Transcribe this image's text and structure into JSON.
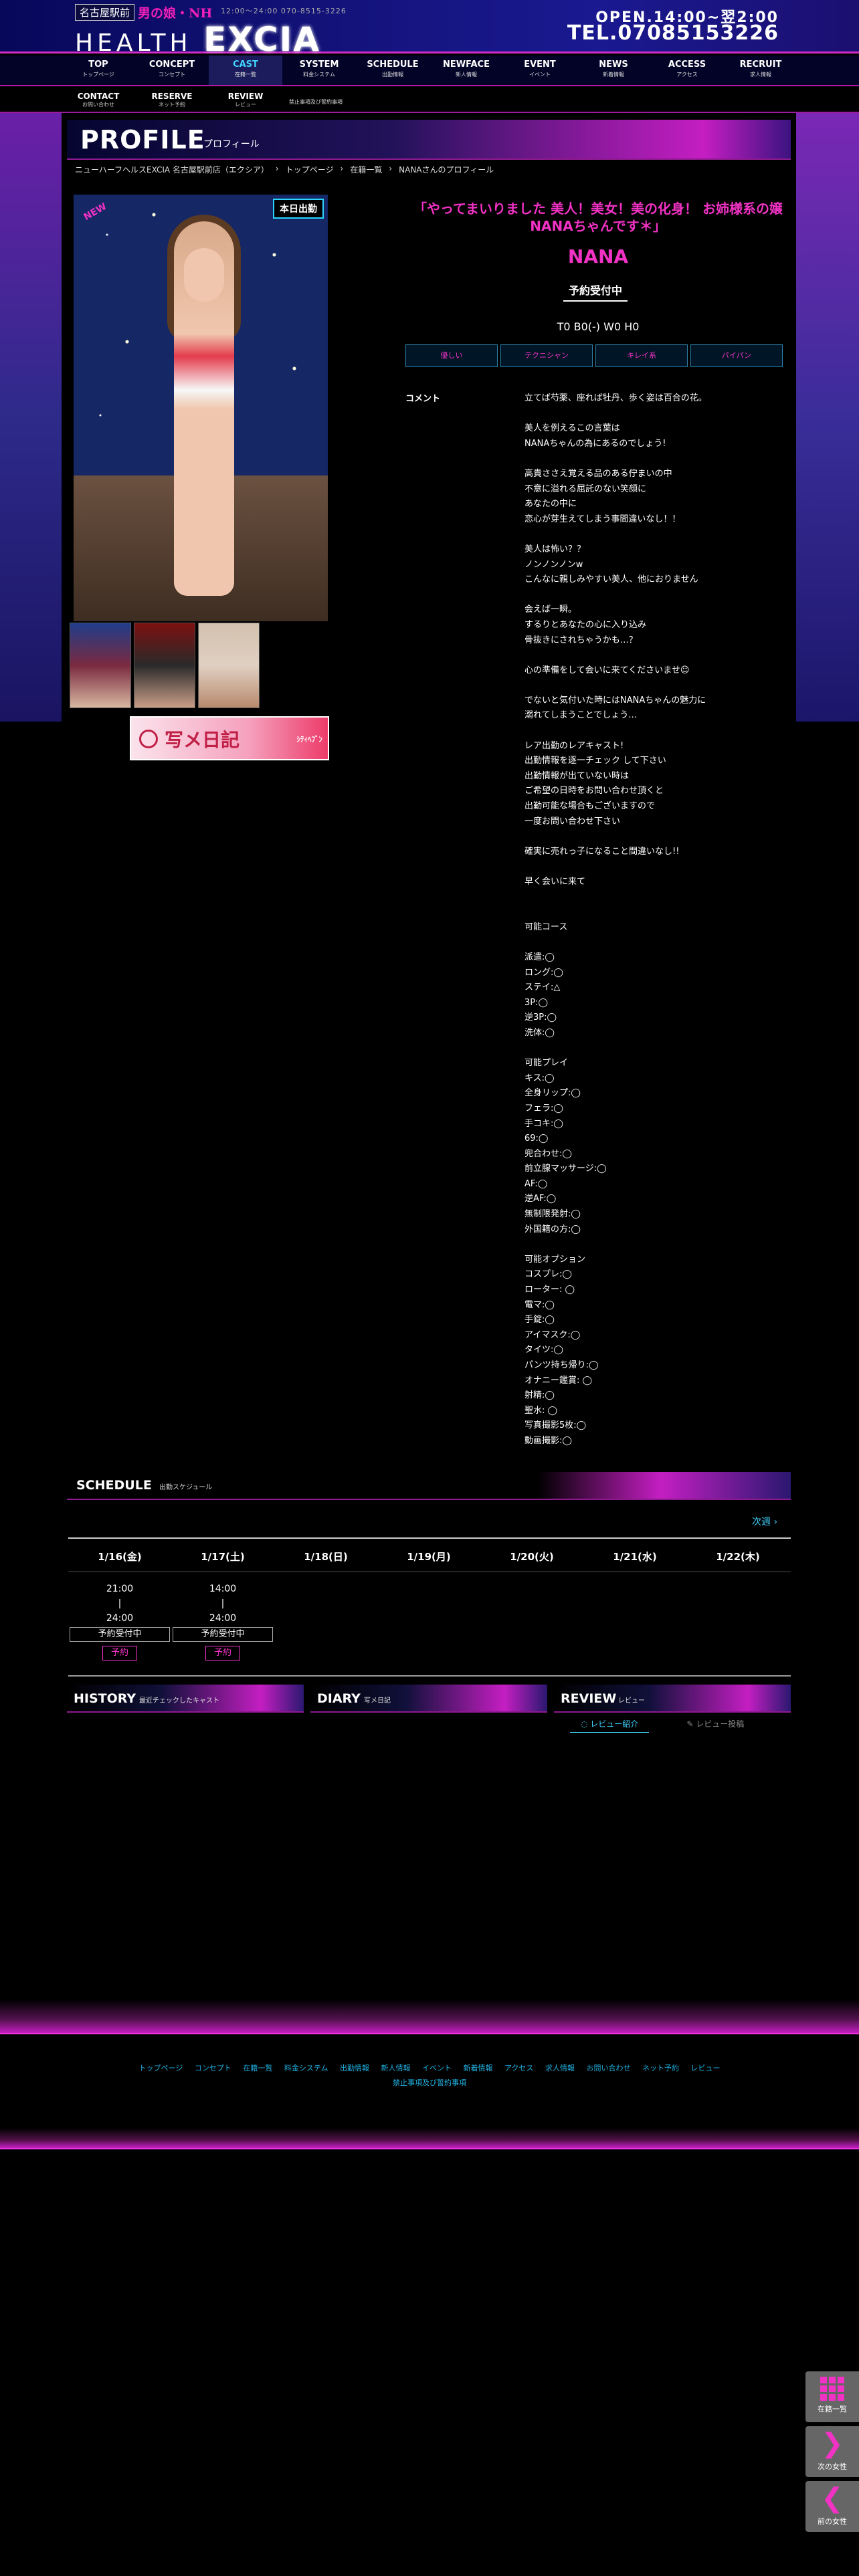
{
  "header": {
    "area_tag": "名古屋駅前",
    "sub_title": "男の娘・NH",
    "hours_small": "12:00～24:00 070-8515-3226",
    "logo_prefix": "HEALTH",
    "logo_brand": "EXCIA",
    "open": "OPEN.14:00~翌2:00",
    "tel": "TEL.07085153226"
  },
  "nav": [
    {
      "en": "TOP",
      "jp": "トップページ"
    },
    {
      "en": "CONCEPT",
      "jp": "コンセプト"
    },
    {
      "en": "CAST",
      "jp": "在籍一覧"
    },
    {
      "en": "SYSTEM",
      "jp": "料金システム"
    },
    {
      "en": "SCHEDULE",
      "jp": "出勤情報"
    },
    {
      "en": "NEWFACE",
      "jp": "新人情報"
    },
    {
      "en": "EVENT",
      "jp": "イベント"
    },
    {
      "en": "NEWS",
      "jp": "新着情報"
    },
    {
      "en": "ACCESS",
      "jp": "アクセス"
    },
    {
      "en": "RECRUIT",
      "jp": "求人情報"
    }
  ],
  "subnav": [
    {
      "en": "CONTACT",
      "jp": "お問い合わせ"
    },
    {
      "en": "RESERVE",
      "jp": "ネット予約"
    },
    {
      "en": "REVIEW",
      "jp": "レビュー"
    }
  ],
  "subnav_ban": "禁止事項及び誓約事項",
  "profile": {
    "title_en": "PROFILE",
    "title_jp": "プロフィール"
  },
  "breadcrumb": [
    "ニューハーフヘルスEXCIA 名古屋駅前店（エクシア）",
    "トップページ",
    "在籍一覧",
    "NANAさんのプロフィール"
  ],
  "photo": {
    "badge_new": "NEW",
    "badge_today": "本日出勤"
  },
  "diary_banner": {
    "text": "写メ日記",
    "sub": "ｼﾃｨﾍﾌﾞﾝ"
  },
  "cast": {
    "catch": "「やってまいりました 美人！美女！美の化身！ お姉様系の嬢 NANAちゃんです＊」",
    "name": "NANA",
    "status": "予約受付中",
    "spec": "T0 B0(-) W0 H0",
    "tags": [
      "優しい",
      "テクニシャン",
      "キレイ系",
      "パイパン"
    ],
    "comment_label": "コメント",
    "comment": "立てば芍薬、座れば牡丹、歩く姿は百合の花。\n\n美人を例えるこの言葉は\nNANAちゃんの為にあるのでしょう!\n\n高貴ささえ覚える品のある佇まいの中\n不意に溢れる屈託のない笑顔に\nあなたの中に\n恋心が芽生えてしまう事間違いなし！！\n\n美人は怖い？？\nノンノンノンw\nこんなに親しみやすい美人、他におりません\n\n会えば一瞬。\nするりとあなたの心に入り込み\n骨抜きにされちゃうかも…？\n\n心の準備をして会いに来てくださいませ☺\n\nでないと気付いた時にはNANAちゃんの魅力に\n溺れてしまうことでしょう…\n\nレア出勤のレアキャスト!\n出勤情報を逐一チェック して下さい\n出勤情報が出ていない時は\nご希望の日時をお問い合わせ頂くと\n出勤可能な場合もございますので\n一度お問い合わせ下さい\n\n確実に売れっ子になること間違いなし!!\n\n早く会いに来て\n\n\n可能コース\n\n派遣:◯\nロング:◯\nステイ:△\n3P:◯\n逆3P:◯\n洗体:◯\n\n可能プレイ\nキス:◯\n全身リップ:◯\nフェラ:◯\n手コキ:◯\n69:◯\n兜合わせ:◯\n前立腺マッサージ:◯\nAF:◯\n逆AF:◯\n無制限発射:◯\n外国籍の方:◯\n\n可能オプション\nコスプレ:◯\nローター: ◯\n電マ:◯\n手錠:◯\nアイマスク:◯\nタイツ:◯\nパンツ持ち帰り:◯\nオナニー鑑賞: ◯\n射精:◯\n聖水: ◯\n写真撮影5枚:◯\n動画撮影:◯"
  },
  "schedule": {
    "title_en": "SCHEDULE",
    "title_jp": "出勤スケジュール",
    "next": "次週",
    "days": [
      "1/16(金)",
      "1/17(土)",
      "1/18(日)",
      "1/19(月)",
      "1/20(火)",
      "1/21(水)",
      "1/22(木)"
    ],
    "shifts": [
      {
        "start": "21:00",
        "sep": "|",
        "end": "24:00",
        "status": "予約受付中",
        "btn": "予約"
      },
      {
        "start": "14:00",
        "sep": "|",
        "end": "24:00",
        "status": "予約受付中",
        "btn": "予約"
      }
    ]
  },
  "bottom": [
    {
      "en": "HISTORY",
      "jp": "最近チェックしたキャスト"
    },
    {
      "en": "DIARY",
      "jp": "写メ日記"
    },
    {
      "en": "REVIEW",
      "jp": "レビュー"
    }
  ],
  "review_tabs": [
    "レビュー紹介",
    "レビュー投稿"
  ],
  "footer_links": [
    "トップページ",
    "コンセプト",
    "在籍一覧",
    "料金システム",
    "出勤情報",
    "新人情報",
    "イベント",
    "新着情報",
    "アクセス",
    "求人情報",
    "お問い合わせ",
    "ネット予約",
    "レビュー"
  ],
  "footer_ban": "禁止事項及び誓約事項",
  "floaters": [
    {
      "label": "在籍一覧",
      "icon": "grid-icon"
    },
    {
      "label": "次の女性",
      "icon": "chevron-right-icon"
    },
    {
      "label": "前の女性",
      "icon": "chevron-left-icon"
    }
  ]
}
